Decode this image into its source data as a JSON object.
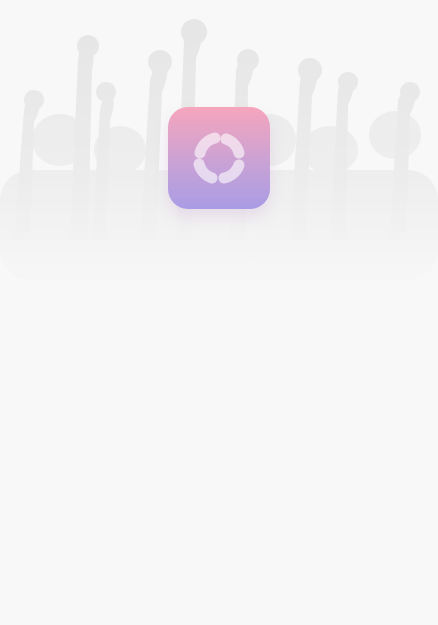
{
  "splash": {
    "background": "concert-crowd-photo",
    "logo": {
      "icon": "ring-segments-icon",
      "gradient_top": "#f6a5bc",
      "gradient_bottom": "#a99ce4"
    }
  }
}
